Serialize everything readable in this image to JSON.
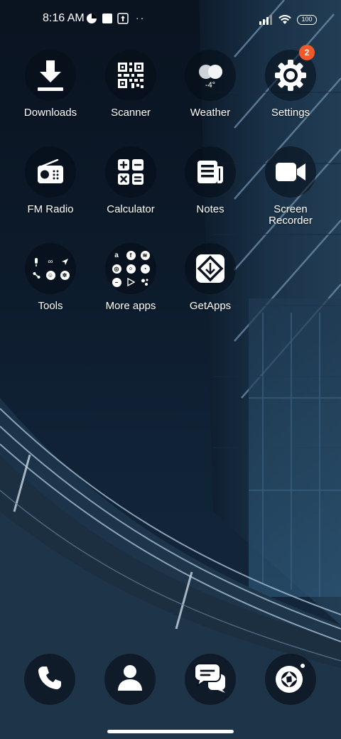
{
  "status_bar": {
    "time": "8:16 AM",
    "battery": "100",
    "more_indicator": "··"
  },
  "apps": [
    {
      "id": "downloads",
      "label": "Downloads",
      "icon": "download-icon"
    },
    {
      "id": "scanner",
      "label": "Scanner",
      "icon": "qr-code-icon"
    },
    {
      "id": "weather",
      "label": "Weather",
      "icon": "cloud-icon",
      "temperature": "-4°"
    },
    {
      "id": "settings",
      "label": "Settings",
      "icon": "gear-icon",
      "badge": "2"
    },
    {
      "id": "fm-radio",
      "label": "FM Radio",
      "icon": "radio-icon"
    },
    {
      "id": "calculator",
      "label": "Calculator",
      "icon": "calculator-icon"
    },
    {
      "id": "notes",
      "label": "Notes",
      "icon": "notes-icon"
    },
    {
      "id": "screen-recorder",
      "label": "Screen\nRecorder",
      "icon": "video-camera-icon"
    },
    {
      "id": "tools",
      "label": "Tools",
      "icon": "tools-folder-icon"
    },
    {
      "id": "more-apps",
      "label": "More apps",
      "icon": "apps-folder-icon"
    },
    {
      "id": "getapps",
      "label": "GetApps",
      "icon": "getapps-icon"
    }
  ],
  "dock": [
    {
      "id": "phone",
      "icon": "phone-icon"
    },
    {
      "id": "contacts",
      "icon": "person-icon"
    },
    {
      "id": "messages",
      "icon": "chat-bubbles-icon"
    },
    {
      "id": "camera",
      "icon": "camera-aperture-icon"
    }
  ],
  "colors": {
    "badge": "#f05a28",
    "icon_bg": "#0c1420",
    "wallpaper_dark": "#0a1320",
    "wallpaper_glass": "#2d5472"
  }
}
